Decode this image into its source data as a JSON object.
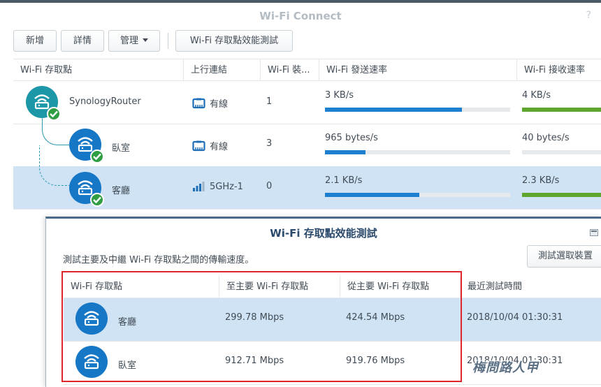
{
  "window": {
    "title": "Wi-Fi Connect",
    "help": "?"
  },
  "toolbar": {
    "add": "新增",
    "details": "詳情",
    "manage": "管理",
    "perf_test": "Wi-Fi 存取點效能測試"
  },
  "main": {
    "columns": [
      "Wi-Fi 存取點",
      "上行連結",
      "Wi-Fi 裝...",
      "Wi-Fi 發送速率",
      "Wi-Fi 接收速率"
    ],
    "rows": [
      {
        "name": "SynologyRouter",
        "uplink": "有線",
        "uplink_icon": "ethernet-icon",
        "devices": "1",
        "tx": "3 KB/s",
        "tx_level": 0.74,
        "rx": "4 KB/s",
        "rx_level": 1.0,
        "selected": false
      },
      {
        "name": "臥室",
        "uplink": "有線",
        "uplink_icon": "ethernet-icon",
        "devices": "3",
        "tx": "965 bytes/s",
        "tx_level": 0.22,
        "rx": "40 bytes/s",
        "rx_level": 0.0,
        "selected": false
      },
      {
        "name": "客廳",
        "uplink": "5GHz-1",
        "uplink_icon": "wifi-signal-icon",
        "devices": "0",
        "tx": "2.1 KB/s",
        "tx_level": 0.51,
        "rx": "2.3 KB/s",
        "rx_level": 1.0,
        "selected": true
      }
    ]
  },
  "dialog": {
    "title": "Wi-Fi 存取點效能測試",
    "description": "測試主要及中繼 Wi-Fi 存取點之間的傳輸速度。",
    "test_selected": "測試選取裝置",
    "columns": [
      "Wi-Fi 存取點",
      "至主要 Wi-Fi 存取點",
      "從主要 Wi-Fi 存取點",
      "最近測試時間"
    ],
    "rows": [
      {
        "name": "客廳",
        "to_primary": "299.78 Mbps",
        "from_primary": "424.54 Mbps",
        "last_test": "2018/10/04 01:30:31",
        "selected": true
      },
      {
        "name": "臥室",
        "to_primary": "912.71 Mbps",
        "from_primary": "919.76 Mbps",
        "last_test": "2018/10/04 01:30:31",
        "selected": false
      }
    ]
  },
  "watermark": "梅問路人甲",
  "colors": {
    "accent_blue": "#1577c6",
    "router_teal": "#1b97a8",
    "status_green": "#2f9e43",
    "selection": "#cfe3f4",
    "highlight_box": "#e0262d"
  }
}
